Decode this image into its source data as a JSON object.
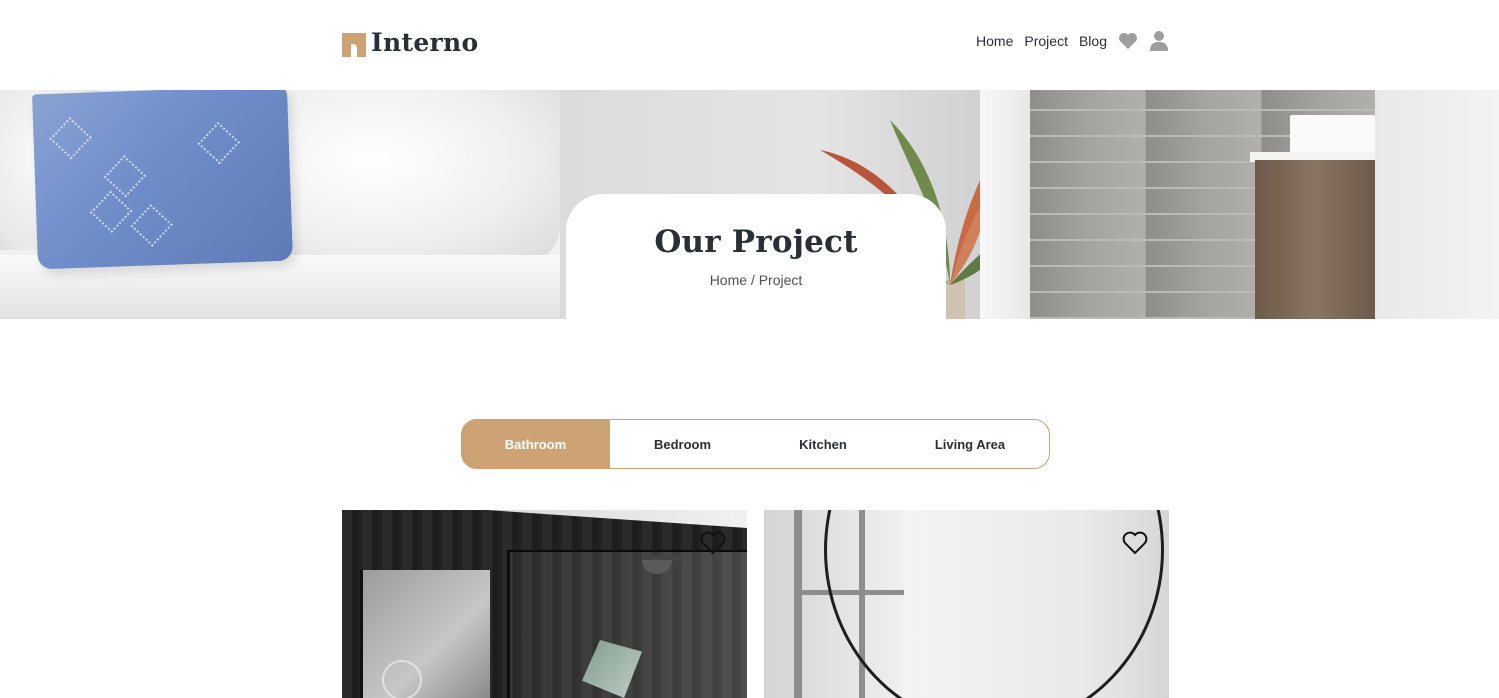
{
  "brand": {
    "name": "Interno",
    "accent_color": "#cda274",
    "text_color": "#292f36"
  },
  "nav": {
    "items": [
      {
        "label": "Home"
      },
      {
        "label": "Project"
      },
      {
        "label": "Blog"
      }
    ],
    "icons": [
      "heart-icon",
      "user-icon"
    ]
  },
  "hero": {
    "title": "Our Project",
    "breadcrumb": {
      "home": "Home",
      "separator": " / ",
      "current": "Project"
    }
  },
  "tabs": {
    "items": [
      {
        "label": "Bathroom",
        "active": true
      },
      {
        "label": "Bedroom",
        "active": false
      },
      {
        "label": "Kitchen",
        "active": false
      },
      {
        "label": "Living Area",
        "active": false
      }
    ]
  },
  "projects": [
    {
      "image": "dark-bathroom-photo",
      "favorite_icon": "heart-outline-icon"
    },
    {
      "image": "white-bathroom-round-mirror-photo",
      "favorite_icon": "heart-outline-icon"
    }
  ]
}
